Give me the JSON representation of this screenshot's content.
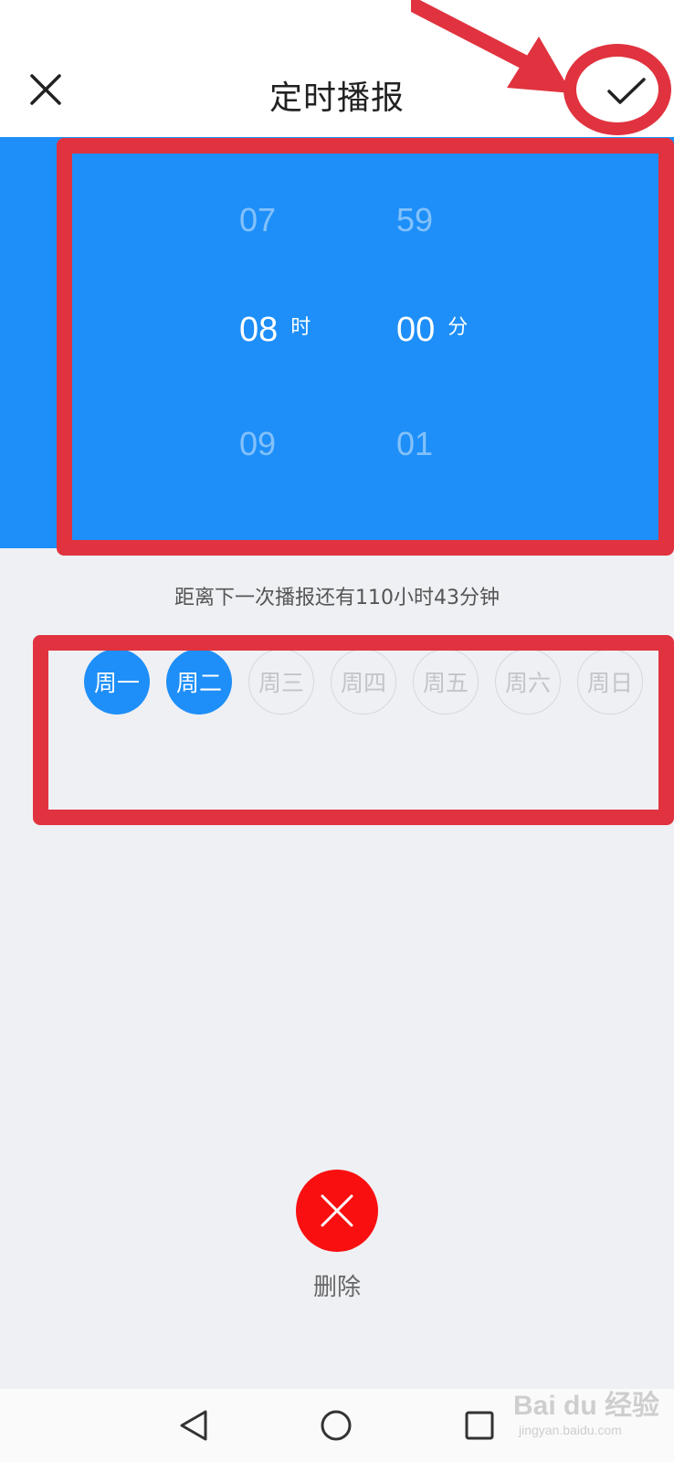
{
  "header": {
    "title": "定时播报",
    "close_icon": "close-icon",
    "confirm_icon": "checkmark-icon"
  },
  "time_picker": {
    "hour": {
      "prev": "07",
      "selected": "08",
      "next": "09",
      "unit": "时"
    },
    "minute": {
      "prev": "59",
      "selected": "00",
      "next": "01",
      "unit": "分"
    }
  },
  "countdown": "距离下一次播报还有110小时43分钟",
  "weekdays": [
    {
      "label": "周一",
      "selected": true
    },
    {
      "label": "周二",
      "selected": true
    },
    {
      "label": "周三",
      "selected": false
    },
    {
      "label": "周四",
      "selected": false
    },
    {
      "label": "周五",
      "selected": false
    },
    {
      "label": "周六",
      "selected": false
    },
    {
      "label": "周日",
      "selected": false
    }
  ],
  "delete": {
    "label": "删除",
    "icon": "close-icon"
  },
  "nav": [
    "back-triangle-icon",
    "home-circle-icon",
    "recent-square-icon"
  ],
  "watermark": {
    "text": "Bai du 经验",
    "sub": "jingyan.baidu.com"
  },
  "colors": {
    "accent": "#1e8ff8",
    "delete": "#f90f0f",
    "annotation": "#e0333f",
    "background": "#eff0f4"
  }
}
